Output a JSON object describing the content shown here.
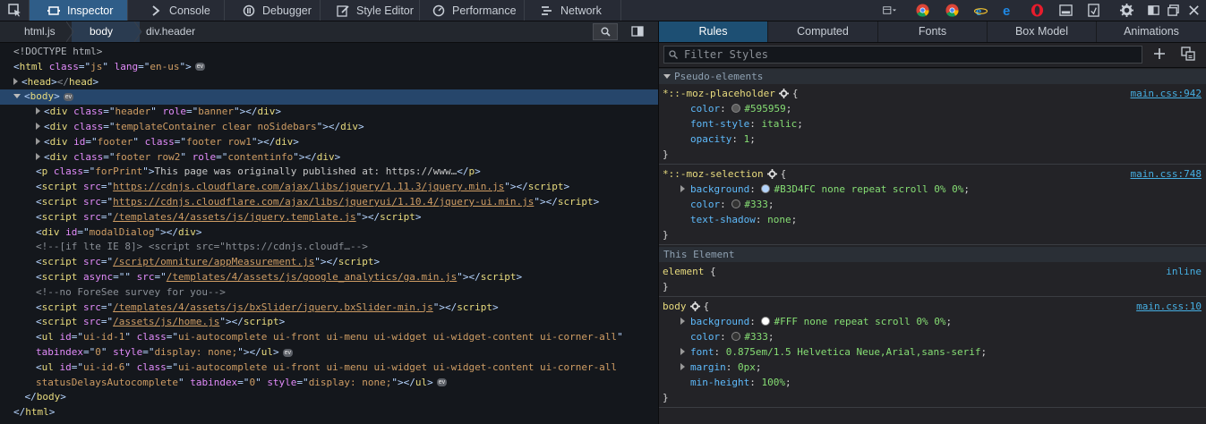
{
  "toolbar": {
    "tabs": [
      {
        "label": "Inspector",
        "icon": "inspector-icon"
      },
      {
        "label": "Console",
        "icon": "console-icon"
      },
      {
        "label": "Debugger",
        "icon": "debugger-icon"
      },
      {
        "label": "Style Editor",
        "icon": "style-editor-icon"
      },
      {
        "label": "Performance",
        "icon": "performance-icon"
      },
      {
        "label": "Network",
        "icon": "network-icon"
      }
    ],
    "selected_tab": "Inspector",
    "right_icons": [
      "responsive-design-icon",
      "chrome-icon",
      "chrome-icon",
      "internet-explorer-icon",
      "edge-icon",
      "opera-icon",
      "screenshot-icon",
      "scratchpad-icon",
      "settings-icon",
      "dock-side-icon",
      "dock-window-icon",
      "close-icon"
    ]
  },
  "breadcrumbs": {
    "items": [
      "html.js",
      "body",
      "div.header"
    ],
    "selected": "body"
  },
  "markup": {
    "lines": [
      {
        "indent": 0,
        "twisty": "none",
        "parts": [
          [
            "dt",
            "<!DOCTYPE html>"
          ]
        ]
      },
      {
        "indent": 0,
        "twisty": "none",
        "parts": [
          [
            "tg",
            "<"
          ],
          [
            "tn",
            "html"
          ],
          [
            "tx",
            " "
          ],
          [
            "an",
            "class"
          ],
          [
            "tg",
            "=\""
          ],
          [
            "av",
            "js"
          ],
          [
            "tg",
            "\" "
          ],
          [
            "an",
            "lang"
          ],
          [
            "tg",
            "=\""
          ],
          [
            "av",
            "en-us"
          ],
          [
            "tg",
            "\">"
          ]
        ],
        "badge": "ev"
      },
      {
        "indent": 0,
        "twisty": "closed",
        "parts": [
          [
            "tg",
            "<"
          ],
          [
            "tn",
            "head"
          ],
          [
            "tg",
            ">"
          ],
          [
            "cm",
            "</"
          ],
          [
            "tn",
            "head"
          ],
          [
            "tg",
            ">"
          ]
        ]
      },
      {
        "indent": 0,
        "twisty": "open",
        "selected": true,
        "parts": [
          [
            "tg",
            "<"
          ],
          [
            "tn",
            "body"
          ],
          [
            "tg",
            ">"
          ]
        ],
        "badge": "ev"
      },
      {
        "indent": 1,
        "twisty": "closed",
        "parts": [
          [
            "tg",
            "<"
          ],
          [
            "tn",
            "div"
          ],
          [
            "tx",
            " "
          ],
          [
            "an",
            "class"
          ],
          [
            "tg",
            "=\""
          ],
          [
            "av",
            "header"
          ],
          [
            "tg",
            "\" "
          ],
          [
            "an",
            "role"
          ],
          [
            "tg",
            "=\""
          ],
          [
            "av",
            "banner"
          ],
          [
            "tg",
            "\">"
          ],
          [
            "tg",
            "</"
          ],
          [
            "tn",
            "div"
          ],
          [
            "tg",
            ">"
          ]
        ]
      },
      {
        "indent": 1,
        "twisty": "closed",
        "parts": [
          [
            "tg",
            "<"
          ],
          [
            "tn",
            "div"
          ],
          [
            "tx",
            " "
          ],
          [
            "an",
            "class"
          ],
          [
            "tg",
            "=\""
          ],
          [
            "av",
            "templateContainer clear noSidebars"
          ],
          [
            "tg",
            "\">"
          ],
          [
            "tg",
            "</"
          ],
          [
            "tn",
            "div"
          ],
          [
            "tg",
            ">"
          ]
        ]
      },
      {
        "indent": 1,
        "twisty": "closed",
        "parts": [
          [
            "tg",
            "<"
          ],
          [
            "tn",
            "div"
          ],
          [
            "tx",
            " "
          ],
          [
            "an",
            "id"
          ],
          [
            "tg",
            "=\""
          ],
          [
            "av",
            "footer"
          ],
          [
            "tg",
            "\" "
          ],
          [
            "an",
            "class"
          ],
          [
            "tg",
            "=\""
          ],
          [
            "av",
            "footer row1"
          ],
          [
            "tg",
            "\">"
          ],
          [
            "tg",
            "</"
          ],
          [
            "tn",
            "div"
          ],
          [
            "tg",
            ">"
          ]
        ]
      },
      {
        "indent": 1,
        "twisty": "closed",
        "parts": [
          [
            "tg",
            "<"
          ],
          [
            "tn",
            "div"
          ],
          [
            "tx",
            " "
          ],
          [
            "an",
            "class"
          ],
          [
            "tg",
            "=\""
          ],
          [
            "av",
            "footer row2"
          ],
          [
            "tg",
            "\" "
          ],
          [
            "an",
            "role"
          ],
          [
            "tg",
            "=\""
          ],
          [
            "av",
            "contentinfo"
          ],
          [
            "tg",
            "\">"
          ],
          [
            "tg",
            "</"
          ],
          [
            "tn",
            "div"
          ],
          [
            "tg",
            ">"
          ]
        ]
      },
      {
        "indent": 1,
        "twisty": "none",
        "parts": [
          [
            "tg",
            "<"
          ],
          [
            "tn",
            "p"
          ],
          [
            "tx",
            " "
          ],
          [
            "an",
            "class"
          ],
          [
            "tg",
            "=\""
          ],
          [
            "av",
            "forPrint"
          ],
          [
            "tg",
            "\">"
          ],
          [
            "tx",
            "This page was originally published at: https://www…"
          ],
          [
            "tg",
            "</"
          ],
          [
            "tn",
            "p"
          ],
          [
            "tg",
            ">"
          ]
        ]
      },
      {
        "indent": 1,
        "twisty": "none",
        "parts": [
          [
            "tg",
            "<"
          ],
          [
            "tn",
            "script"
          ],
          [
            "tx",
            " "
          ],
          [
            "an",
            "src"
          ],
          [
            "tg",
            "=\""
          ],
          [
            "avl",
            "https://cdnjs.cloudflare.com/ajax/libs/jquery/1.11.3/jquery.min.js"
          ],
          [
            "tg",
            "\">"
          ],
          [
            "tg",
            "</"
          ],
          [
            "tn",
            "script"
          ],
          [
            "tg",
            ">"
          ]
        ]
      },
      {
        "indent": 1,
        "twisty": "none",
        "parts": [
          [
            "tg",
            "<"
          ],
          [
            "tn",
            "script"
          ],
          [
            "tx",
            " "
          ],
          [
            "an",
            "src"
          ],
          [
            "tg",
            "=\""
          ],
          [
            "avl",
            "https://cdnjs.cloudflare.com/ajax/libs/jqueryui/1.10.4/jquery-ui.min.js"
          ],
          [
            "tg",
            "\">"
          ],
          [
            "tg",
            "</"
          ],
          [
            "tn",
            "script"
          ],
          [
            "tg",
            ">"
          ]
        ]
      },
      {
        "indent": 1,
        "twisty": "none",
        "parts": [
          [
            "tg",
            "<"
          ],
          [
            "tn",
            "script"
          ],
          [
            "tx",
            " "
          ],
          [
            "an",
            "src"
          ],
          [
            "tg",
            "=\""
          ],
          [
            "avl",
            "/templates/4/assets/js/jquery.template.js"
          ],
          [
            "tg",
            "\">"
          ],
          [
            "tg",
            "</"
          ],
          [
            "tn",
            "script"
          ],
          [
            "tg",
            ">"
          ]
        ]
      },
      {
        "indent": 1,
        "twisty": "none",
        "parts": [
          [
            "tg",
            "<"
          ],
          [
            "tn",
            "div"
          ],
          [
            "tx",
            " "
          ],
          [
            "an",
            "id"
          ],
          [
            "tg",
            "=\""
          ],
          [
            "av",
            "modalDialog"
          ],
          [
            "tg",
            "\">"
          ],
          [
            "tg",
            "</"
          ],
          [
            "tn",
            "div"
          ],
          [
            "tg",
            ">"
          ]
        ]
      },
      {
        "indent": 1,
        "twisty": "none",
        "parts": [
          [
            "cm",
            "<!--[if lte IE 8]> <script src=\"https://cdnjs.cloudf…-->"
          ]
        ]
      },
      {
        "indent": 1,
        "twisty": "none",
        "parts": [
          [
            "tg",
            "<"
          ],
          [
            "tn",
            "script"
          ],
          [
            "tx",
            " "
          ],
          [
            "an",
            "src"
          ],
          [
            "tg",
            "=\""
          ],
          [
            "avl",
            "/script/omniture/appMeasurement.js"
          ],
          [
            "tg",
            "\">"
          ],
          [
            "tg",
            "</"
          ],
          [
            "tn",
            "script"
          ],
          [
            "tg",
            ">"
          ]
        ]
      },
      {
        "indent": 1,
        "twisty": "none",
        "parts": [
          [
            "tg",
            "<"
          ],
          [
            "tn",
            "script"
          ],
          [
            "tx",
            " "
          ],
          [
            "an",
            "async"
          ],
          [
            "tg",
            "=\"\" "
          ],
          [
            "an",
            "src"
          ],
          [
            "tg",
            "=\""
          ],
          [
            "avl",
            "/templates/4/assets/js/google_analytics/ga.min.js"
          ],
          [
            "tg",
            "\">"
          ],
          [
            "tg",
            "</"
          ],
          [
            "tn",
            "script"
          ],
          [
            "tg",
            ">"
          ]
        ]
      },
      {
        "indent": 1,
        "twisty": "none",
        "parts": [
          [
            "cm",
            "<!--no ForeSee survey for you-->"
          ]
        ]
      },
      {
        "indent": 1,
        "twisty": "none",
        "parts": [
          [
            "tg",
            "<"
          ],
          [
            "tn",
            "script"
          ],
          [
            "tx",
            " "
          ],
          [
            "an",
            "src"
          ],
          [
            "tg",
            "=\""
          ],
          [
            "avl",
            "/templates/4/assets/js/bxSlider/jquery.bxSlider-min.js"
          ],
          [
            "tg",
            "\">"
          ],
          [
            "tg",
            "</"
          ],
          [
            "tn",
            "script"
          ],
          [
            "tg",
            ">"
          ]
        ]
      },
      {
        "indent": 1,
        "twisty": "none",
        "parts": [
          [
            "tg",
            "<"
          ],
          [
            "tn",
            "script"
          ],
          [
            "tx",
            " "
          ],
          [
            "an",
            "src"
          ],
          [
            "tg",
            "=\""
          ],
          [
            "avl",
            "/assets/js/home.js"
          ],
          [
            "tg",
            "\">"
          ],
          [
            "tg",
            "</"
          ],
          [
            "tn",
            "script"
          ],
          [
            "tg",
            ">"
          ]
        ]
      },
      {
        "indent": 1,
        "twisty": "none",
        "parts": [
          [
            "tg",
            "<"
          ],
          [
            "tn",
            "ul"
          ],
          [
            "tx",
            " "
          ],
          [
            "an",
            "id"
          ],
          [
            "tg",
            "=\""
          ],
          [
            "av",
            "ui-id-1"
          ],
          [
            "tg",
            "\" "
          ],
          [
            "an",
            "class"
          ],
          [
            "tg",
            "=\""
          ],
          [
            "av",
            "ui-autocomplete ui-front ui-menu ui-widget ui-widget-content ui-corner-all"
          ],
          [
            "tg",
            "\""
          ]
        ]
      },
      {
        "indent": 1,
        "twisty": "none",
        "parts": [
          [
            "an",
            "tabindex"
          ],
          [
            "tg",
            "=\""
          ],
          [
            "av",
            "0"
          ],
          [
            "tg",
            "\" "
          ],
          [
            "an",
            "style"
          ],
          [
            "tg",
            "=\""
          ],
          [
            "av",
            "display: none;"
          ],
          [
            "tg",
            "\">"
          ],
          [
            "tg",
            "</"
          ],
          [
            "tn",
            "ul"
          ],
          [
            "tg",
            ">"
          ]
        ],
        "badge": "ev"
      },
      {
        "indent": 1,
        "twisty": "none",
        "parts": [
          [
            "tg",
            "<"
          ],
          [
            "tn",
            "ul"
          ],
          [
            "tx",
            " "
          ],
          [
            "an",
            "id"
          ],
          [
            "tg",
            "=\""
          ],
          [
            "av",
            "ui-id-6"
          ],
          [
            "tg",
            "\" "
          ],
          [
            "an",
            "class"
          ],
          [
            "tg",
            "=\""
          ],
          [
            "av",
            "ui-autocomplete ui-front ui-menu ui-widget ui-widget-content ui-corner-all"
          ]
        ]
      },
      {
        "indent": 1,
        "twisty": "none",
        "parts": [
          [
            "av",
            "statusDelaysAutocomplete"
          ],
          [
            "tg",
            "\" "
          ],
          [
            "an",
            "tabindex"
          ],
          [
            "tg",
            "=\""
          ],
          [
            "av",
            "0"
          ],
          [
            "tg",
            "\" "
          ],
          [
            "an",
            "style"
          ],
          [
            "tg",
            "=\""
          ],
          [
            "av",
            "display: none;"
          ],
          [
            "tg",
            "\">"
          ],
          [
            "tg",
            "</"
          ],
          [
            "tn",
            "ul"
          ],
          [
            "tg",
            ">"
          ]
        ],
        "badge": "ev"
      },
      {
        "indent": 0.5,
        "twisty": "none",
        "parts": [
          [
            "tg",
            "</"
          ],
          [
            "tn",
            "body"
          ],
          [
            "tg",
            ">"
          ]
        ]
      },
      {
        "indent": 0,
        "twisty": "none",
        "parts": [
          [
            "tg",
            "</"
          ],
          [
            "tn",
            "html"
          ],
          [
            "tg",
            ">"
          ]
        ]
      }
    ]
  },
  "sidebar": {
    "tabs": [
      "Rules",
      "Computed",
      "Fonts",
      "Box Model",
      "Animations"
    ],
    "selected_tab": "Rules",
    "filter_placeholder": "Filter Styles"
  },
  "rules": {
    "pseudo_header": "Pseudo-elements",
    "this_element_header": "This Element",
    "blocks": [
      {
        "selector": "*::-moz-placeholder",
        "source": "main.css:942",
        "gear": true,
        "props": [
          {
            "name": "color",
            "value": "#595959",
            "swatch": "#595959"
          },
          {
            "name": "font-style",
            "value": "italic"
          },
          {
            "name": "opacity",
            "value": "1"
          }
        ]
      },
      {
        "selector": "*::-moz-selection",
        "source": "main.css:748",
        "gear": true,
        "props": [
          {
            "name": "background",
            "value": "#B3D4FC none repeat scroll 0% 0%",
            "swatch": "#B3D4FC",
            "expandable": true
          },
          {
            "name": "color",
            "value": "#333",
            "swatch": "#333333"
          },
          {
            "name": "text-shadow",
            "value": "none"
          }
        ]
      },
      {
        "selector": "element",
        "source": "inline",
        "gear": false,
        "props": []
      },
      {
        "selector": "body",
        "source": "main.css:10",
        "gear": true,
        "props": [
          {
            "name": "background",
            "value": "#FFF none repeat scroll 0% 0%",
            "swatch": "#FFFFFF",
            "expandable": true
          },
          {
            "name": "color",
            "value": "#333",
            "swatch": "#333333"
          },
          {
            "name": "font",
            "value": "0.875em/1.5 Helvetica Neue,Arial,sans-serif",
            "expandable": true
          },
          {
            "name": "margin",
            "value": "0px",
            "expandable": true
          },
          {
            "name": "min-height",
            "value": "100%"
          }
        ]
      }
    ]
  },
  "colors": {
    "toolbar_bg": "#272b35",
    "selected_tab": "#2f5d88",
    "markup_bg": "#14171c",
    "selection_row": "#26466b",
    "link_blue": "#46afe3"
  }
}
